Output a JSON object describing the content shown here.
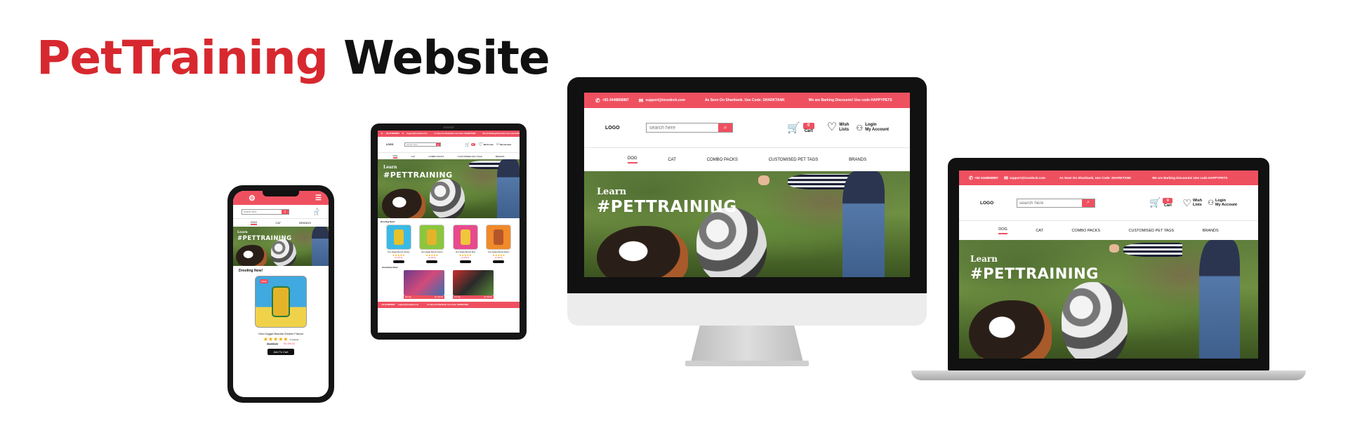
{
  "hero": {
    "title_red": "PetTraining",
    "title_black": "Website"
  },
  "colors": {
    "brand": "#ef5060",
    "title_red": "#d7282f"
  },
  "site": {
    "phone": "+92-3448858887",
    "email": "support@iovedeck.com",
    "promo1": "As Seen On Sharktank. Use Code: SHARKTANK",
    "promo2": "We are Barking Discounts! Use code HAPPYPETS",
    "logo": "LOGO",
    "search_placeholder": "search here",
    "cart_count": "0",
    "cart_label": "Cart",
    "wish_label": "Wish Lists",
    "wish_line1": "Wish",
    "wish_line2": "Lists",
    "login_line1": "Login",
    "login_line2": "My Account",
    "menu": [
      "DOG",
      "CAT",
      "COMBO PACKS",
      "CUSTOMISED PET TAGS",
      "BRANDS"
    ],
    "hero_learn": "Learn",
    "hero_hashtag": "#PETTRAINING"
  },
  "tablet": {
    "section1": "Drooling Now!",
    "section2": "Customise Now",
    "products": [
      {
        "name": "Oreo Doggie Biscuits Chicken",
        "price": "Rs.499.00"
      },
      {
        "name": "Oreo Doggie Biscuits Peanut",
        "price": "Rs.499.00"
      },
      {
        "name": "Oreo Doggie Biscuits Beef",
        "price": "Rs.499.00"
      },
      {
        "name": "Oreo Doggie Biscuits Mutton",
        "price": "Rs.499.00"
      }
    ],
    "tags": [
      {
        "name": "Pet Tag",
        "price": "Rs.499.00"
      },
      {
        "name": "Pet Tag",
        "price": "Rs.499.00"
      }
    ]
  },
  "phone": {
    "section": "Drooling Now!",
    "product_name": "Oreo Doggie Biscuits Chicken Flavour",
    "reviews": "2 reviews",
    "old_price": "Rs.699.00",
    "price": "Rs.499.00",
    "sale": "SALE",
    "add_to_cart": "Add To Cart",
    "menu": [
      "DOG",
      "CAT",
      "BRANDS"
    ]
  }
}
